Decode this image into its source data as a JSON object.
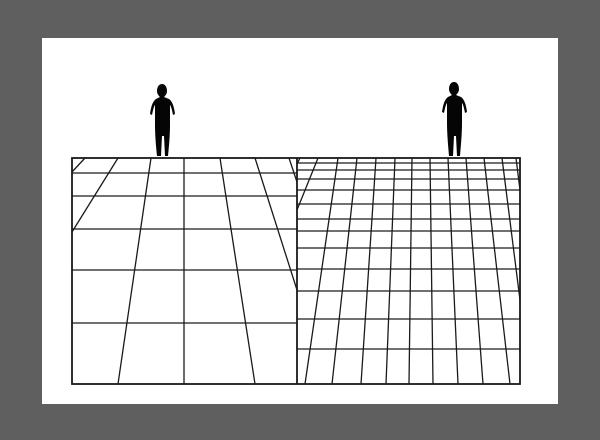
{
  "colors": {
    "backdrop": "#5f5f5f",
    "sheet": "#ffffff",
    "ink": "#1a1a1a",
    "figure": "#050505"
  },
  "panels": [
    {
      "id": "left",
      "description_icon": "coarse-perspective-grid",
      "vertical_divisions": 6,
      "horizontal_rows": 5
    },
    {
      "id": "right",
      "description_icon": "fine-perspective-grid",
      "vertical_divisions": 12,
      "horizontal_rows": 12
    }
  ],
  "figures": [
    {
      "id": "left-figure",
      "icon": "standing-person-silhouette"
    },
    {
      "id": "right-figure",
      "icon": "standing-person-silhouette"
    }
  ]
}
